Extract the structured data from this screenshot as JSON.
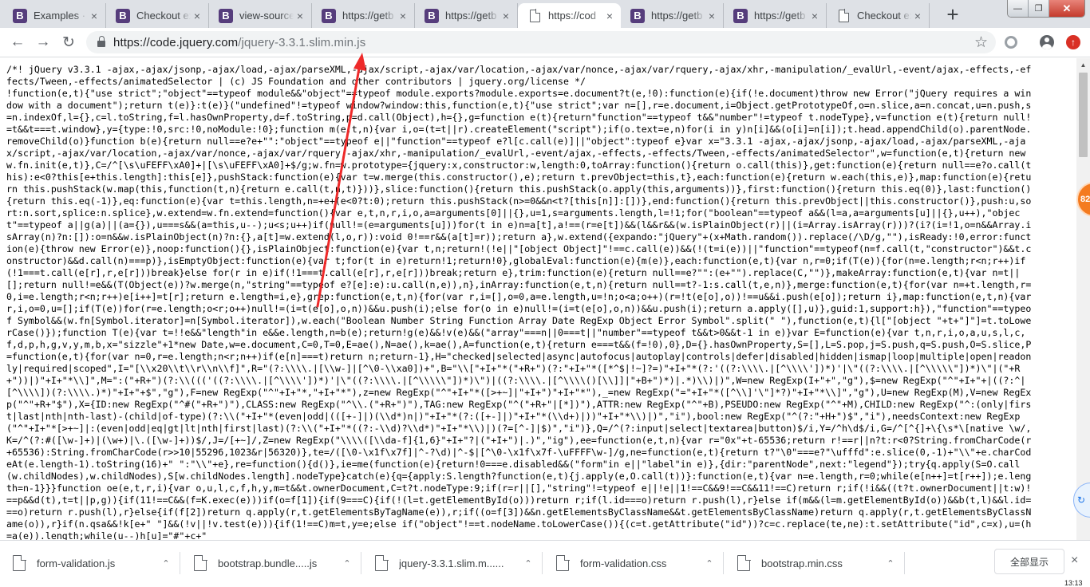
{
  "tabs": [
    {
      "title": "Examples · B",
      "icon": "bootstrap-icon",
      "active": false
    },
    {
      "title": "Checkout ex",
      "icon": "bootstrap-icon",
      "active": false
    },
    {
      "title": "view-source:",
      "icon": "bootstrap-icon",
      "active": false
    },
    {
      "title": "https://getb",
      "icon": "bootstrap-icon",
      "active": false
    },
    {
      "title": "https://getb",
      "icon": "bootstrap-icon",
      "active": false
    },
    {
      "title": "https://cod",
      "icon": "page-icon",
      "active": true
    },
    {
      "title": "https://getb",
      "icon": "bootstrap-icon",
      "active": false
    },
    {
      "title": "https://getb",
      "icon": "bootstrap-icon",
      "active": false
    },
    {
      "title": "Checkout ex",
      "icon": "page-icon",
      "active": false
    }
  ],
  "tab_icon_letter": "B",
  "tab_close_glyph": "×",
  "new_tab_glyph": "+",
  "window": {
    "minimize": "—",
    "maximize": "❐",
    "close": "✕"
  },
  "toolbar": {
    "back": "←",
    "forward": "→",
    "reload": "↻",
    "url_host": "https://code.jquery.com",
    "url_path": "/jquery-3.3.1.slim.min.js",
    "star": "☆",
    "update_glyph": "↑"
  },
  "source_text": "/*! jQuery v3.3.1 -ajax,-ajax/jsonp,-ajax/load,-ajax/parseXML,-ajax/script,-ajax/var/location,-ajax/var/nonce,-ajax/var/rquery,-ajax/xhr,-manipulation/_evalUrl,-event/ajax,-effects,-effects/Tween,-effects/animatedSelector | (c) JS Foundation and other contributors | jquery.org/license */\n!function(e,t){\"use strict\";\"object\"==typeof module&&\"object\"==typeof module.exports?module.exports=e.document?t(e,!0):function(e){if(!e.document)throw new Error(\"jQuery requires a window with a document\");return t(e)}:t(e)}(\"undefined\"!=typeof window?window:this,function(e,t){\"use strict\";var n=[],r=e.document,i=Object.getPrototypeOf,o=n.slice,a=n.concat,u=n.push,s=n.indexOf,l={},c=l.toString,f=l.hasOwnProperty,d=f.toString,p=d.call(Object),h={},g=function e(t){return\"function\"==typeof t&&\"number\"!=typeof t.nodeType},v=function e(t){return null!=t&&t===t.window},y={type:!0,src:!0,noModule:!0};function m(e,t,n){var i,o=(t=t||r).createElement(\"script\");if(o.text=e,n)for(i in y)n[i]&&(o[i]=n[i]);t.head.appendChild(o).parentNode.removeChild(o)}function b(e){return null==e?e+\"\":\"object\"==typeof e||\"function\"==typeof e?l[c.call(e)]||\"object\":typeof e}var x=\"3.3.1 -ajax,-ajax/jsonp,-ajax/load,-ajax/parseXML,-ajax/script,-ajax/var/location,-ajax/var/nonce,-ajax/var/rquery,-ajax/xhr,-manipulation/_evalUrl,-event/ajax,-effects,-effects/Tween,-effects/animatedSelector\",w=function(e,t){return new w.fn.init(e,t)},C=/^[\\s\\uFEFF\\xA0]+|[\\s\\uFEFF\\xA0]+$/g;w.fn=w.prototype={jquery:x,constructor:w,length:0,toArray:function(){return o.call(this)},get:function(e){return null==e?o.call(this):e<0?this[e+this.length]:this[e]},pushStack:function(e){var t=w.merge(this.constructor(),e);return t.prevObject=this,t},each:function(e){return w.each(this,e)},map:function(e){return this.pushStack(w.map(this,function(t,n){return e.call(t,n,t)}))},slice:function(){return this.pushStack(o.apply(this,arguments))},first:function(){return this.eq(0)},last:function(){return this.eq(-1)},eq:function(e){var t=this.length,n=+e+(e<0?t:0);return this.pushStack(n>=0&&n<t?[this[n]]:[])},end:function(){return this.prevObject||this.constructor()},push:u,sort:n.sort,splice:n.splice},w.extend=w.fn.extend=function(){var e,t,n,r,i,o,a=arguments[0]||{},u=1,s=arguments.length,l=!1;for(\"boolean\"==typeof a&&(l=a,a=arguments[u]||{},u++),\"object\"==typeof a||g(a)||(a={}),u===s&&(a=this,u--);u<s;u++)if(null!=(e=arguments[u]))for(t in e)n=a[t],a!==(r=e[t])&&(l&&r&&(w.isPlainObject(r)||(i=Array.isArray(r)))?(i?(i=!1,o=n&&Array.isArray(n)?n:[]):o=n&&w.isPlainObject(n)?n:{},a[t]=w.extend(l,o,r)):void 0!==r&&(a[t]=r));return a},w.extend({expando:\"jQuery\"+(x+Math.random()).replace(/\\D/g,\"\"),isReady:!0,error:function(e){throw new Error(e)},noop:function(){},isPlainObject:function(e){var t,n;return!(!e||\"[object Object]\"!==c.call(e))&&(!(t=i(e))||\"function\"==typeof(n=f.call(t,\"constructor\")&&t.constructor)&&d.call(n)===p)},isEmptyObject:function(e){var t;for(t in e)return!1;return!0},globalEval:function(e){m(e)},each:function(e,t){var n,r=0;if(T(e)){for(n=e.length;r<n;r++)if(!1===t.call(e[r],r,e[r]))break}else for(r in e)if(!1===t.call(e[r],r,e[r]))break;return e},trim:function(e){return null==e?\"\":(e+\"\").replace(C,\"\")},makeArray:function(e,t){var n=t||[];return null!=e&&(T(Object(e))?w.merge(n,\"string\"==typeof e?[e]:e):u.call(n,e)),n},inArray:function(e,t,n){return null==t?-1:s.call(t,e,n)},merge:function(e,t){for(var n=+t.length,r=0,i=e.length;r<n;r++)e[i++]=t[r];return e.length=i,e},grep:function(e,t,n){for(var r,i=[],o=0,a=e.length,u=!n;o<a;o++)(r=!t(e[o],o))!==u&&i.push(e[o]);return i},map:function(e,t,n){var r,i,o=0,u=[];if(T(e))for(r=e.length;o<r;o++)null!=(i=t(e[o],o,n))&&u.push(i);else for(o in e)null!=(i=t(e[o],o,n))&&u.push(i);return a.apply([],u)},guid:1,support:h}),\"function\"==typeof Symbol&&(w.fn[Symbol.iterator]=n[Symbol.iterator]),w.each(\"Boolean Number String Function Array Date RegExp Object Error Symbol\".split(\" \"),function(e,t){l[\"[object \"+t+\"]\"]=t.toLowerCase()});function T(e){var t=!!e&&\"length\"in e&&e.length,n=b(e);return!g(e)&&!v(e)&&(\"array\"===n||0===t||\"number\"==typeof t&&t>0&&t-1 in e)}var E=function(e){var t,n,r,i,o,a,u,s,l,c,f,d,p,h,g,v,y,m,b,x=\"sizzle\"+1*new Date,w=e.document,C=0,T=0,E=ae(),N=ae(),k=ae(),A=function(e,t){return e===t&&(f=!0),0},D={}.hasOwnProperty,S=[],L=S.pop,j=S.push,q=S.push,O=S.slice,P=function(e,t){for(var n=0,r=e.length;n<r;n++)if(e[n]===t)return n;return-1},H=\"checked|selected|async|autofocus|autoplay|controls|defer|disabled|hidden|ismap|loop|multiple|open|readonly|required|scoped\",I=\"[\\\\x20\\\\t\\\\r\\\\n\\\\f]\",R=\"(?:\\\\\\\\.|[\\\\w-]|[^\\0-\\\\xa0])+\",B=\"\\\\[\"+I+\"*(\"+R+\")(?:\"+I+\"*([*^$|!~]?=)\"+I+\"*(?:'((?:\\\\\\\\.|[^\\\\\\\\'])*)'|\\\"((?:\\\\\\\\.|[^\\\\\\\\\\\"])*)\\\"|(\"+R+\"))|)\"+I+\"*\\\\]\",M=\":(\"+R+\")(?:\\\\((('((?:\\\\\\\\.|[^\\\\\\\\'])*)'|\\\"((?:\\\\\\\\.|[^\\\\\\\\\\\"])*)\\\")|((?:\\\\\\\\.|[^\\\\\\\\()[\\\\]]|\"+B+\")*)|.*)\\\\)|)\",W=new RegExp(I+\"+\",\"g\"),$=new RegExp(\"^\"+I+\"+|((?:^|[^\\\\\\\\])(?:\\\\\\\\.)*)\"+I+\"+$\",\"g\"),F=new RegExp(\"^\"+I+\"*,\"+I+\"*\"),z=new RegExp(\"^\"+I+\"*([>+~]|\"+I+\")\"+I+\"*\"),_=new RegExp(\"=\"+I+\"*([^\\\\]'\\\"]*?)\"+I+\"*\\\\]\",\"g\"),U=new RegExp(M),V=new RegExp(\"^\"+R+\"$\"),X={ID:new RegExp(\"^#(\"+R+\")\"),CLASS:new RegExp(\"^\\\\.(\"+R+\")\"),TAG:new RegExp(\"^(\"+R+\"|[*])\"),ATTR:new RegExp(\"^\"+B),PSEUDO:new RegExp(\"^\"+M),CHILD:new RegExp(\"^:(only|first|last|nth|nth-last)-(child|of-type)(?:\\\\(\"+I+\"*(even|odd|(([+-]|)(\\\\d*)n|)\"+I+\"*(?:([+-]|)\"+I+\"*(\\\\d+)|))\"+I+\"*\\\\)|)\",\"i\"),bool:new RegExp(\"^(?:\"+H+\")$\",\"i\"),needsContext:new RegExp(\"^\"+I+\"*[>+~]|:(even|odd|eq|gt|lt|nth|first|last)(?:\\\\(\"+I+\"*((?:-\\\\d)?\\\\d*)\"+I+\"*\\\\)|)(?=[^-]|$)\",\"i\")},Q=/^(?:input|select|textarea|button)$/i,Y=/^h\\d$/i,G=/^[^{]+\\{\\s*\\[native \\w/,K=/^(?:#([\\w-]+)|(\\w+)|\\.([\\w-]+))$/,J=/[+~]/,Z=new RegExp(\"\\\\\\\\([\\\\da-f]{1,6}\"+I+\"?|(\"+I+\")|.)\",\"ig\"),ee=function(e,t,n){var r=\"0x\"+t-65536;return r!==r||n?t:r<0?String.fromCharCode(r+65536):String.fromCharCode(r>>10|55296,1023&r|56320)},te=/([\\0-\\x1f\\x7f]|^-?\\d)|^-$|[^\\0-\\x1f\\x7f-\\uFFFF\\w-]/g,ne=function(e,t){return t?\"\\0\"===e?\"\\ufffd\":e.slice(0,-1)+\"\\\\\"+e.charCodeAt(e.length-1).toString(16)+\" \":\"\\\\\"+e},re=function(){d()},ie=me(function(e){return!0===e.disabled&&(\"form\"in e||\"label\"in e)},{dir:\"parentNode\",next:\"legend\"});try{q.apply(S=O.call(w.childNodes),w.childNodes),S[w.childNodes.length].nodeType}catch(e){q={apply:S.length?function(e,t){j.apply(e,O.call(t))}:function(e,t){var n=e.length,r=0;while(e[n++]=t[r++]);e.length=n-1}}}function oe(e,t,r,i){var o,u,l,c,f,h,y,m=t&&t.ownerDocument,C=t?t.nodeType:9;if(r=r||[],\"string\"!=typeof e||!e||1!==C&&9!==C&&11!==C)return r;if(!i&&((t?t.ownerDocument||t:w)!==p&&d(t),t=t||p,g)){if(11!==C&&(f=K.exec(e)))if(o=f[1]){if(9===C){if(!(l=t.getElementById(o)))return r;if(l.id===o)return r.push(l),r}else if(m&&(l=m.getElementById(o))&&b(t,l)&&l.id===o)return r.push(l),r}else{if(f[2])return q.apply(r,t.getElementsByTagName(e)),r;if((o=f[3])&&n.getElementsByClassName&&t.getElementsByClassName)return q.apply(r,t.getElementsByClassName(o)),r}if(n.qsa&&!k[e+\" \"]&&(!v||!v.test(e))){if(1!==C)m=t,y=e;else if(\"object\"!==t.nodeName.toLowerCase()){(c=t.getAttribute(\"id\"))?c=c.replace(te,ne):t.setAttribute(\"id\",c=x),u=(h=a(e)).length;while(u--)h[u]=\"#\"+c+\"",
  "side_badge": "82",
  "side_blue_glyph": "↻",
  "downloads": [
    {
      "name": "form-validation.js"
    },
    {
      "name": "bootstrap.bundle.....js"
    },
    {
      "name": "jquery-3.3.1.slim.m......"
    },
    {
      "name": "form-validation.css"
    },
    {
      "name": "bootstrap.min.css"
    }
  ],
  "download_chevron": "⌃",
  "show_all": "全部显示",
  "shelf_close": "×",
  "clock": "13:13"
}
